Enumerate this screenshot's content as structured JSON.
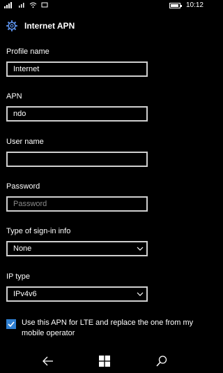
{
  "status_bar": {
    "time": "10:12",
    "battery_level": 0.9
  },
  "header": {
    "title": "Internet APN",
    "icon": "gear-icon"
  },
  "form": {
    "profile_name": {
      "label": "Profile name",
      "value": "Internet"
    },
    "apn": {
      "label": "APN",
      "value": "ndo"
    },
    "user_name": {
      "label": "User name",
      "value": ""
    },
    "password": {
      "label": "Password",
      "placeholder": "Password",
      "value": ""
    },
    "sign_in_type": {
      "label": "Type of sign-in info",
      "selected": "None"
    },
    "ip_type": {
      "label": "IP type",
      "selected": "IPv4v6"
    },
    "lte_checkbox": {
      "checked": true,
      "label": "Use this APN for LTE and replace the one from my mobile operator"
    }
  },
  "colors": {
    "accent": "#2f7fd1",
    "background": "#000000",
    "field_border": "#cfcfcf"
  }
}
